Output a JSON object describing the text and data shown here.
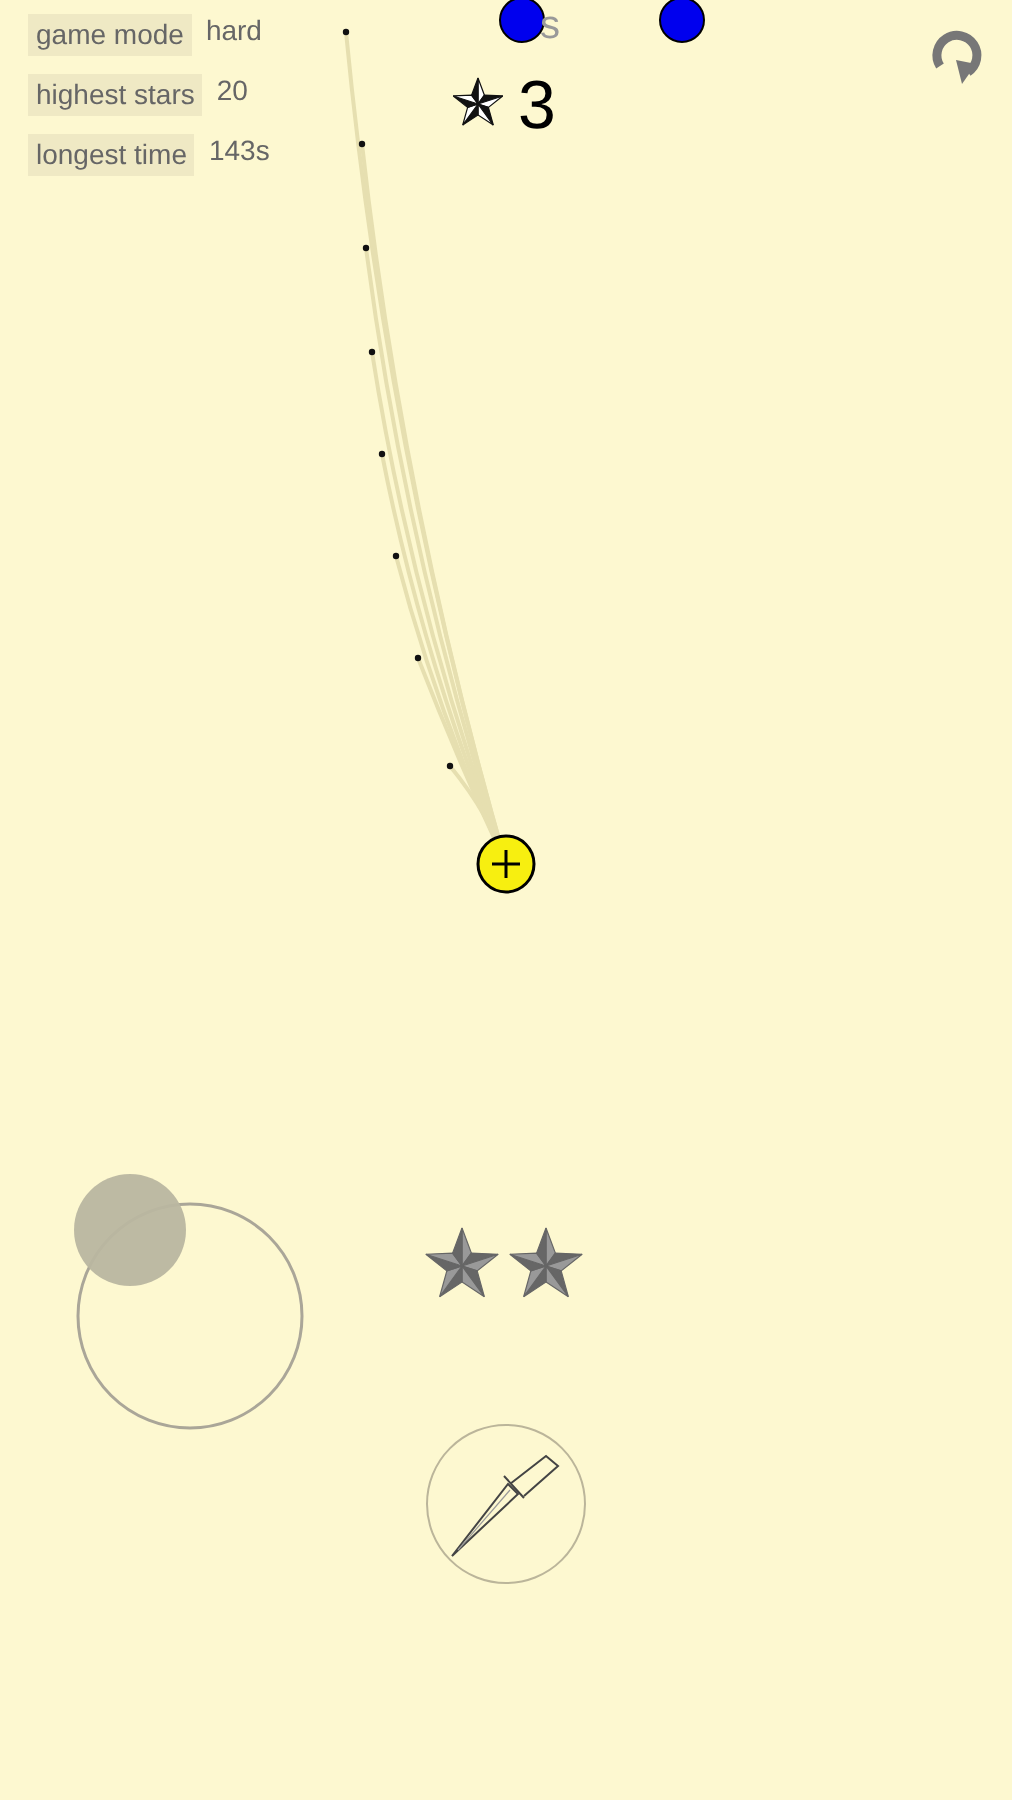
{
  "stats": [
    {
      "label": "game mode",
      "value": "hard"
    },
    {
      "label": "highest stars",
      "value": "20"
    },
    {
      "label": "longest time",
      "value": "143s"
    }
  ],
  "timer": "s",
  "score": "3"
}
